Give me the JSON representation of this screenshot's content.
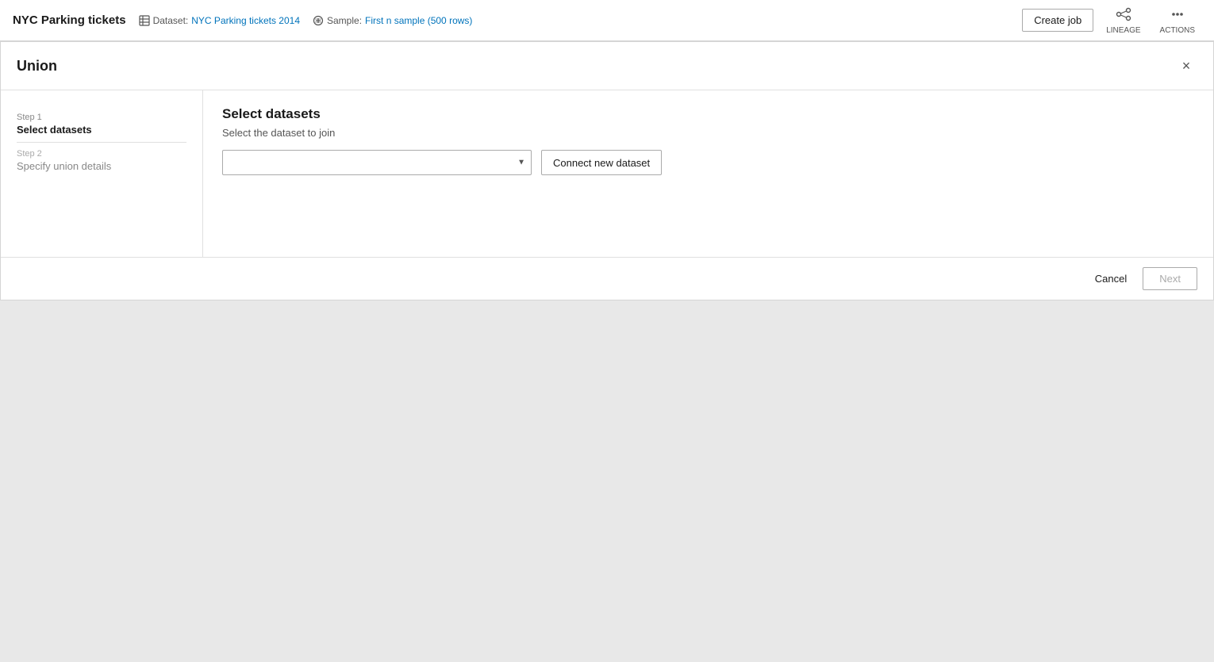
{
  "app": {
    "title": "NYC Parking tickets",
    "dataset_label": "Dataset:",
    "dataset_link": "NYC Parking tickets 2014",
    "sample_label": "Sample:",
    "sample_link": "First n sample (500 rows)"
  },
  "toolbar": {
    "create_job_label": "Create job",
    "lineage_label": "LINEAGE",
    "actions_label": "ACTIONS"
  },
  "dialog": {
    "title": "Union",
    "close_label": "×",
    "step1_label": "Step 1",
    "step1_name": "Select datasets",
    "step2_label": "Step 2",
    "step2_name": "Specify union details",
    "content_title": "Select datasets",
    "content_subtitle": "Select the dataset to join",
    "connect_button_label": "Connect new dataset",
    "cancel_label": "Cancel",
    "next_label": "Next",
    "select_placeholder": ""
  }
}
